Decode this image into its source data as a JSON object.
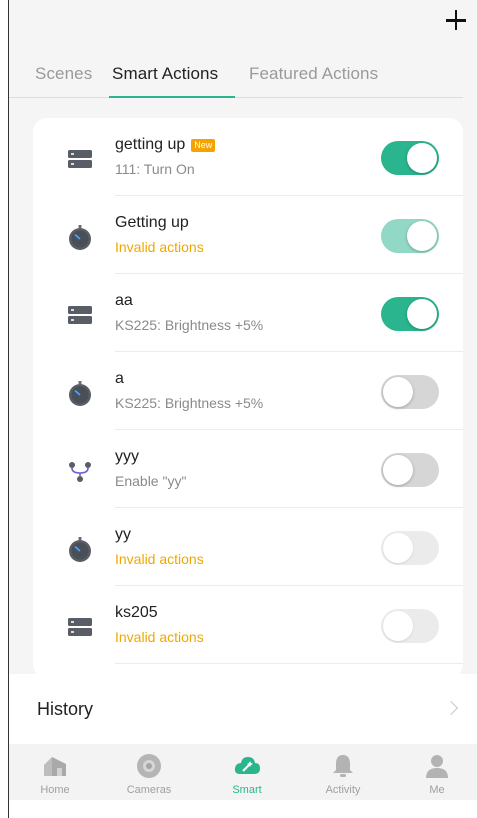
{
  "header": {
    "add_icon": "plus-icon"
  },
  "tabs": [
    {
      "label": "Scenes",
      "active": false
    },
    {
      "label": "Smart Actions",
      "active": true
    },
    {
      "label": "Featured Actions",
      "active": false
    }
  ],
  "actions": [
    {
      "title": "getting up",
      "badge": "New",
      "subtitle": "111: Turn On",
      "subtitle_invalid": false,
      "icon": "hub-icon",
      "toggle": "on"
    },
    {
      "title": "Getting up",
      "subtitle": "Invalid actions",
      "subtitle_invalid": true,
      "icon": "timer-icon",
      "toggle": "on-faded"
    },
    {
      "title": "aa",
      "subtitle": "KS225: Brightness +5%",
      "subtitle_invalid": false,
      "icon": "hub-icon",
      "toggle": "on"
    },
    {
      "title": "a",
      "subtitle": "KS225: Brightness +5%",
      "subtitle_invalid": false,
      "icon": "timer-icon",
      "toggle": "off"
    },
    {
      "title": "yyy",
      "subtitle": "Enable \"yy\"",
      "subtitle_invalid": false,
      "icon": "branch-icon",
      "toggle": "off"
    },
    {
      "title": "yy",
      "subtitle": "Invalid actions",
      "subtitle_invalid": true,
      "icon": "timer-icon",
      "toggle": "off-faded"
    },
    {
      "title": "ks205",
      "subtitle": "Invalid actions",
      "subtitle_invalid": true,
      "icon": "hub-icon",
      "toggle": "off-faded"
    }
  ],
  "history": {
    "label": "History"
  },
  "nav": [
    {
      "label": "Home",
      "icon": "home-icon",
      "active": false
    },
    {
      "label": "Cameras",
      "icon": "camera-icon",
      "active": false
    },
    {
      "label": "Smart",
      "icon": "smart-icon",
      "active": true
    },
    {
      "label": "Activity",
      "icon": "bell-icon",
      "active": false
    },
    {
      "label": "Me",
      "icon": "person-icon",
      "active": false
    }
  ],
  "colors": {
    "accent": "#2bb58e",
    "accent_faded": "#92d8c6",
    "invalid": "#f0a800",
    "badge": "#f5a300"
  }
}
